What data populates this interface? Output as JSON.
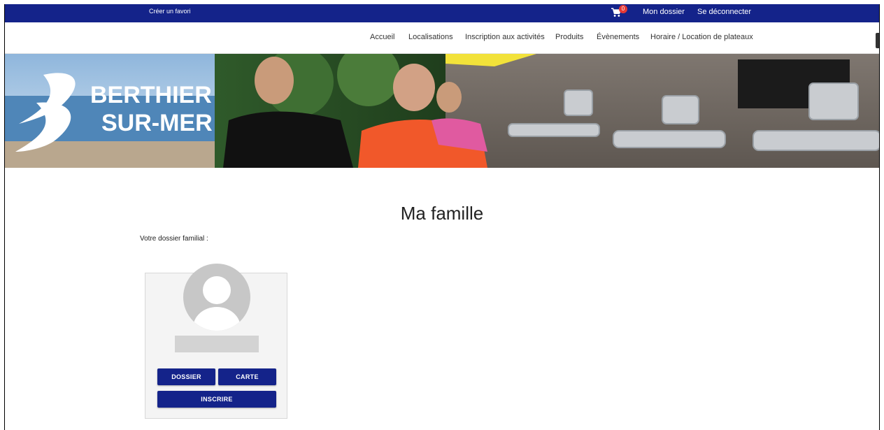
{
  "topbar": {
    "favorite_link": "Créer un favori",
    "cart_count": "0",
    "my_file": "Mon dossier",
    "logout": "Se déconnecter"
  },
  "nav": {
    "items": [
      "Accueil",
      "Localisations",
      "Inscription aux activités",
      "Produits",
      "Évènements",
      "Horaire / Location de plateaux"
    ]
  },
  "banner": {
    "logo_line1": "BERTHIER",
    "logo_line2": "SUR-MER"
  },
  "main": {
    "title": "Ma famille",
    "dossier_label": "Votre dossier familial :"
  },
  "card": {
    "btn_dossier": "DOSSIER",
    "btn_carte": "CARTE",
    "btn_inscrire": "INSCRIRE"
  },
  "colors": {
    "primary": "#14238a",
    "badge": "#e53935"
  },
  "icons": [
    "cart-icon",
    "avatar-placeholder-icon"
  ]
}
